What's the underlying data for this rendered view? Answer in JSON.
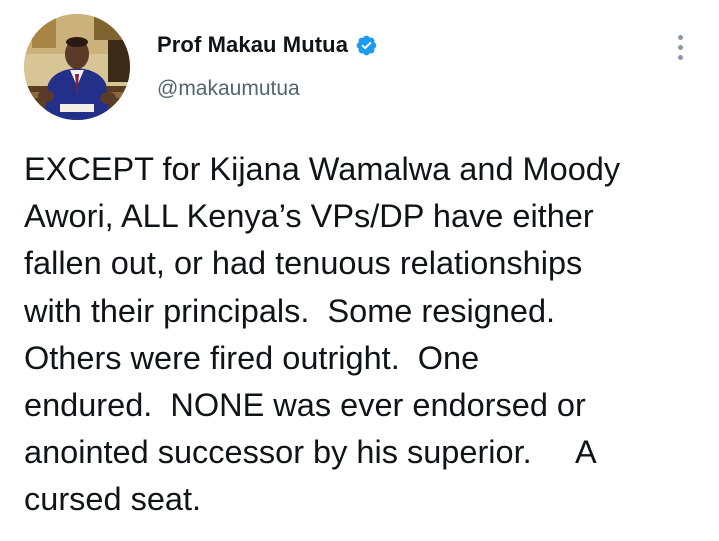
{
  "author": {
    "display_name": "Prof Makau Mutua",
    "handle": "@makaumutua",
    "verified": true,
    "verified_icon": "verified-badge-icon",
    "verified_color": "#1d9bf0"
  },
  "menu": {
    "icon": "more-options-icon"
  },
  "tweet": {
    "text": "EXCEPT for Kijana Wamalwa and Moody\nAwori, ALL Kenya’s VPs/DP have either\nfallen out, or had tenuous relationships\nwith their principals.  Some resigned.\nOthers were fired outright.  One\nendured.  NONE was ever endorsed or\nanointed successor by his superior.     A\ncursed seat."
  },
  "colors": {
    "text": "#0f1419",
    "secondary": "#536471",
    "accent": "#1d9bf0"
  }
}
